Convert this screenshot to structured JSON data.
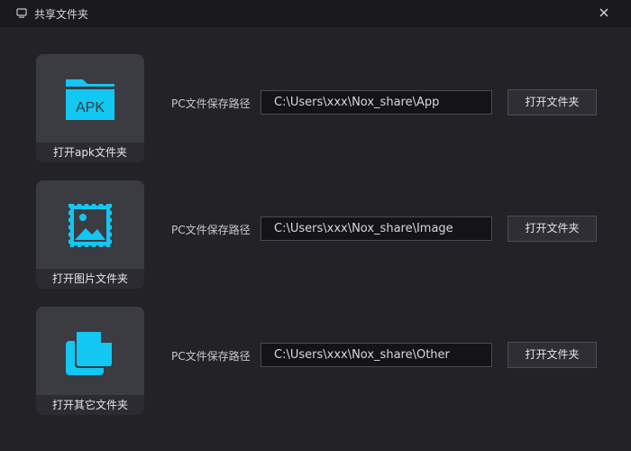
{
  "window": {
    "title": "共享文件夹",
    "icon": "monitor-icon",
    "close_icon": "close-icon"
  },
  "accent_color": "#12c7f2",
  "rows": [
    {
      "tile_icon": "apk-folder-icon",
      "tile_icon_text": "APK",
      "tile_label": "打开apk文件夹",
      "path_label": "PC文件保存路径",
      "path_value": "C:\\Users\\xxx\\Nox_share\\App",
      "button_label": "打开文件夹"
    },
    {
      "tile_icon": "image-icon",
      "tile_label": "打开图片文件夹",
      "path_label": "PC文件保存路径",
      "path_value": "C:\\Users\\xxx\\Nox_share\\Image",
      "button_label": "打开文件夹"
    },
    {
      "tile_icon": "documents-icon",
      "tile_label": "打开其它文件夹",
      "path_label": "PC文件保存路径",
      "path_value": "C:\\Users\\xxx\\Nox_share\\Other",
      "button_label": "打开文件夹"
    }
  ]
}
